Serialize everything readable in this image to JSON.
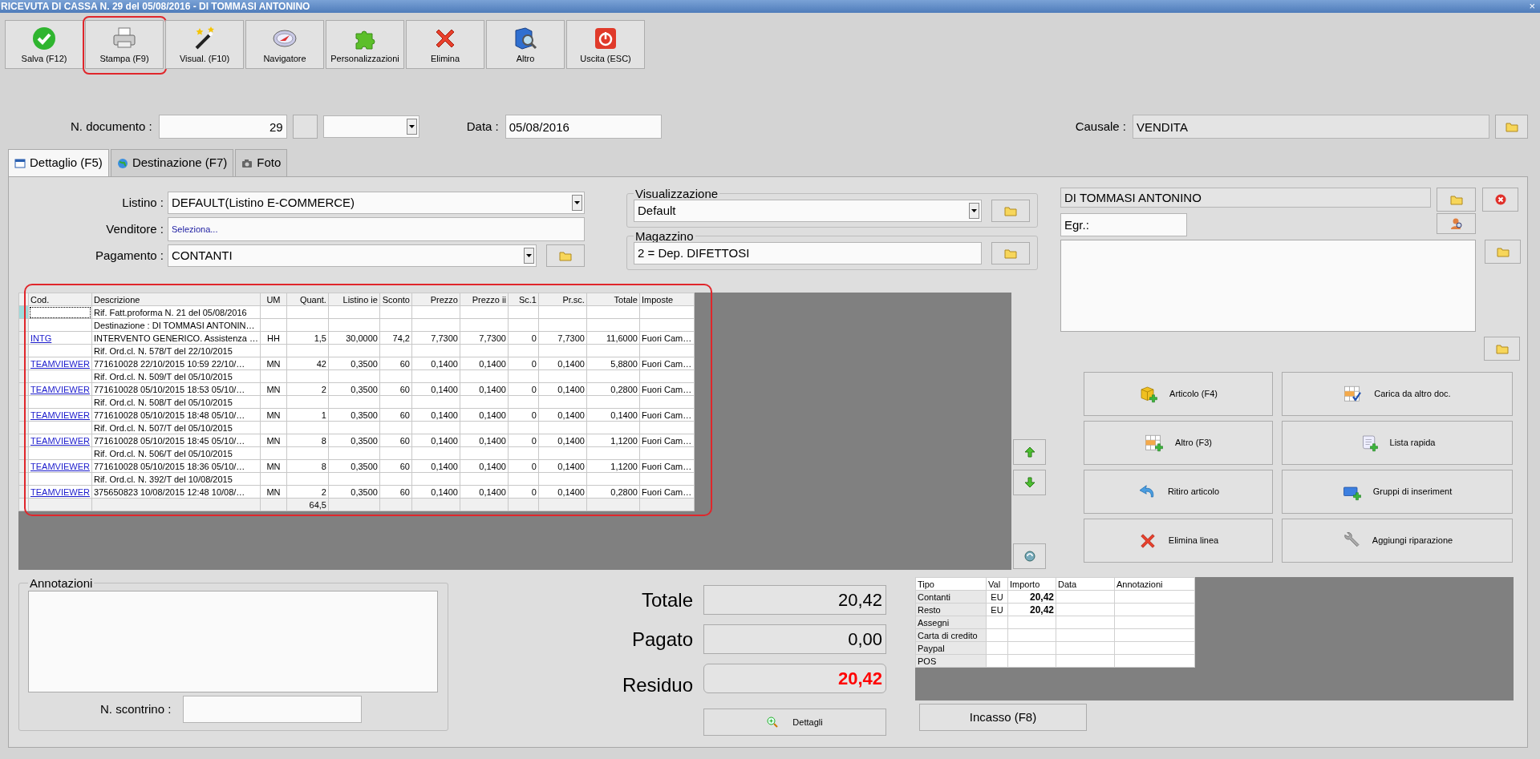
{
  "window": {
    "title": "RICEVUTA DI CASSA N. 29 del 05/08/2016 - DI TOMMASI ANTONINO",
    "close": "×"
  },
  "toolbar": [
    {
      "label": "Salva (F12)",
      "highlighted": false
    },
    {
      "label": "Stampa (F9)",
      "highlighted": true
    },
    {
      "label": "Visual. (F10)",
      "highlighted": false
    },
    {
      "label": "Navigatore",
      "highlighted": false
    },
    {
      "label": "Personalizzazioni",
      "highlighted": false
    },
    {
      "label": "Elimina",
      "highlighted": false
    },
    {
      "label": "Altro",
      "highlighted": false
    },
    {
      "label": "Uscita (ESC)",
      "highlighted": false
    }
  ],
  "header": {
    "n_documento": {
      "label": "N. documento :",
      "value": "29"
    },
    "data": {
      "label": "Data :",
      "value": "05/08/2016"
    },
    "causale": {
      "label": "Causale :",
      "value": "VENDITA"
    }
  },
  "tabs": [
    {
      "label": "Dettaglio (F5)",
      "selected": true
    },
    {
      "label": "Destinazione (F7)",
      "selected": false
    },
    {
      "label": "Foto",
      "selected": false
    }
  ],
  "fields": {
    "listino": {
      "label": "Listino :",
      "value": "DEFAULT(Listino E-COMMERCE)"
    },
    "venditore": {
      "label": "Venditore :",
      "value": "Seleziona..."
    },
    "pagamento": {
      "label": "Pagamento :",
      "value": "CONTANTI"
    }
  },
  "visualizzazione": {
    "legend": "Visualizzazione",
    "value": "Default"
  },
  "magazzino": {
    "legend": "Magazzino",
    "value": "2 = Dep. DIFETTOSI"
  },
  "customer": {
    "name": "DI TOMMASI ANTONINO",
    "salutation": "Egr.:"
  },
  "table": {
    "highlighted": true,
    "columns": [
      "Cod.",
      "Descrizione",
      "UM",
      "Quant.",
      "Listino ie",
      "Sconto",
      "Prezzo",
      "Prezzo ii",
      "Sc.1",
      "Pr.sc.",
      "Totale",
      "Imposte"
    ],
    "rows": [
      {
        "selected": true,
        "descrizione": "Rif. Fatt.proforma N. 21 del 05/08/2016"
      },
      {
        "selected": false,
        "descrizione": "Destinazione : DI TOMMASI ANTONIN…"
      },
      {
        "selected": false,
        "cod": "INTG",
        "descrizione": "INTERVENTO GENERICO. Assistenza …",
        "um": "HH",
        "quant": "1,5",
        "listino": "30,0000",
        "sconto": "74,2",
        "prezzo": "7,7300",
        "prezzo_ii": "7,7300",
        "sc1": "0",
        "prsc": "7,7300",
        "totale": "11,6000",
        "imposte": "Fuori Cam…"
      },
      {
        "selected": false,
        "descrizione": "Rif. Ord.cl. N. 578/T del 22/10/2015"
      },
      {
        "selected": false,
        "cod": "TEAMVIEWER",
        "descrizione": "771610028 22/10/2015 10:59 22/10/…",
        "um": "MN",
        "quant": "42",
        "listino": "0,3500",
        "sconto": "60",
        "prezzo": "0,1400",
        "prezzo_ii": "0,1400",
        "sc1": "0",
        "prsc": "0,1400",
        "totale": "5,8800",
        "imposte": "Fuori Cam…"
      },
      {
        "selected": false,
        "descrizione": "Rif. Ord.cl. N. 509/T del 05/10/2015"
      },
      {
        "selected": false,
        "cod": "TEAMVIEWER",
        "descrizione": "771610028 05/10/2015 18:53 05/10/…",
        "um": "MN",
        "quant": "2",
        "listino": "0,3500",
        "sconto": "60",
        "prezzo": "0,1400",
        "prezzo_ii": "0,1400",
        "sc1": "0",
        "prsc": "0,1400",
        "totale": "0,2800",
        "imposte": "Fuori Cam…"
      },
      {
        "selected": false,
        "descrizione": "Rif. Ord.cl. N. 508/T del 05/10/2015"
      },
      {
        "selected": false,
        "cod": "TEAMVIEWER",
        "descrizione": "771610028 05/10/2015 18:48 05/10/…",
        "um": "MN",
        "quant": "1",
        "listino": "0,3500",
        "sconto": "60",
        "prezzo": "0,1400",
        "prezzo_ii": "0,1400",
        "sc1": "0",
        "prsc": "0,1400",
        "totale": "0,1400",
        "imposte": "Fuori Cam…"
      },
      {
        "selected": false,
        "descrizione": "Rif. Ord.cl. N. 507/T del 05/10/2015"
      },
      {
        "selected": false,
        "cod": "TEAMVIEWER",
        "descrizione": "771610028 05/10/2015 18:45 05/10/…",
        "um": "MN",
        "quant": "8",
        "listino": "0,3500",
        "sconto": "60",
        "prezzo": "0,1400",
        "prezzo_ii": "0,1400",
        "sc1": "0",
        "prsc": "0,1400",
        "totale": "1,1200",
        "imposte": "Fuori Cam…"
      },
      {
        "selected": false,
        "descrizione": "Rif. Ord.cl. N. 506/T del 05/10/2015"
      },
      {
        "selected": false,
        "cod": "TEAMVIEWER",
        "descrizione": "771610028 05/10/2015 18:36 05/10/…",
        "um": "MN",
        "quant": "8",
        "listino": "0,3500",
        "sconto": "60",
        "prezzo": "0,1400",
        "prezzo_ii": "0,1400",
        "sc1": "0",
        "prsc": "0,1400",
        "totale": "1,1200",
        "imposte": "Fuori Cam…"
      },
      {
        "selected": false,
        "descrizione": "Rif. Ord.cl. N. 392/T del 10/08/2015"
      },
      {
        "selected": false,
        "cod": "TEAMVIEWER",
        "descrizione": "375650823 10/08/2015 12:48 10/08/…",
        "um": "MN",
        "quant": "2",
        "listino": "0,3500",
        "sconto": "60",
        "prezzo": "0,1400",
        "prezzo_ii": "0,1400",
        "sc1": "0",
        "prsc": "0,1400",
        "totale": "0,2800",
        "imposte": "Fuori Cam…"
      }
    ],
    "totals": {
      "quant": "64,5"
    }
  },
  "actions": [
    "Articolo (F4)",
    "Carica da altro doc.",
    "Altro (F3)",
    "Lista rapida",
    "Ritiro articolo",
    "Gruppi di inseriment",
    "Elimina linea",
    "Aggiungi riparazione"
  ],
  "annotazioni": {
    "legend": "Annotazioni",
    "scontrino_label": "N. scontrino :"
  },
  "totals": [
    {
      "label": "Totale",
      "value": "20,42",
      "alert": false
    },
    {
      "label": "Pagato",
      "value": "0,00",
      "alert": false
    },
    {
      "label": "Residuo",
      "value": "20,42",
      "alert": true
    }
  ],
  "dettagli_button": "Dettagli",
  "payments": {
    "columns": [
      "Tipo",
      "Val",
      "Importo",
      "Data",
      "Annotazioni"
    ],
    "rows": [
      {
        "tipo": "Contanti",
        "val": "EU",
        "importo": "20,42"
      },
      {
        "tipo": "Resto",
        "val": "EU",
        "importo": "20,42"
      },
      {
        "tipo": "Assegni"
      },
      {
        "tipo": "Carta di credito"
      },
      {
        "tipo": "Paypal"
      },
      {
        "tipo": "POS"
      }
    ]
  },
  "incasso_button": "Incasso (F8)"
}
